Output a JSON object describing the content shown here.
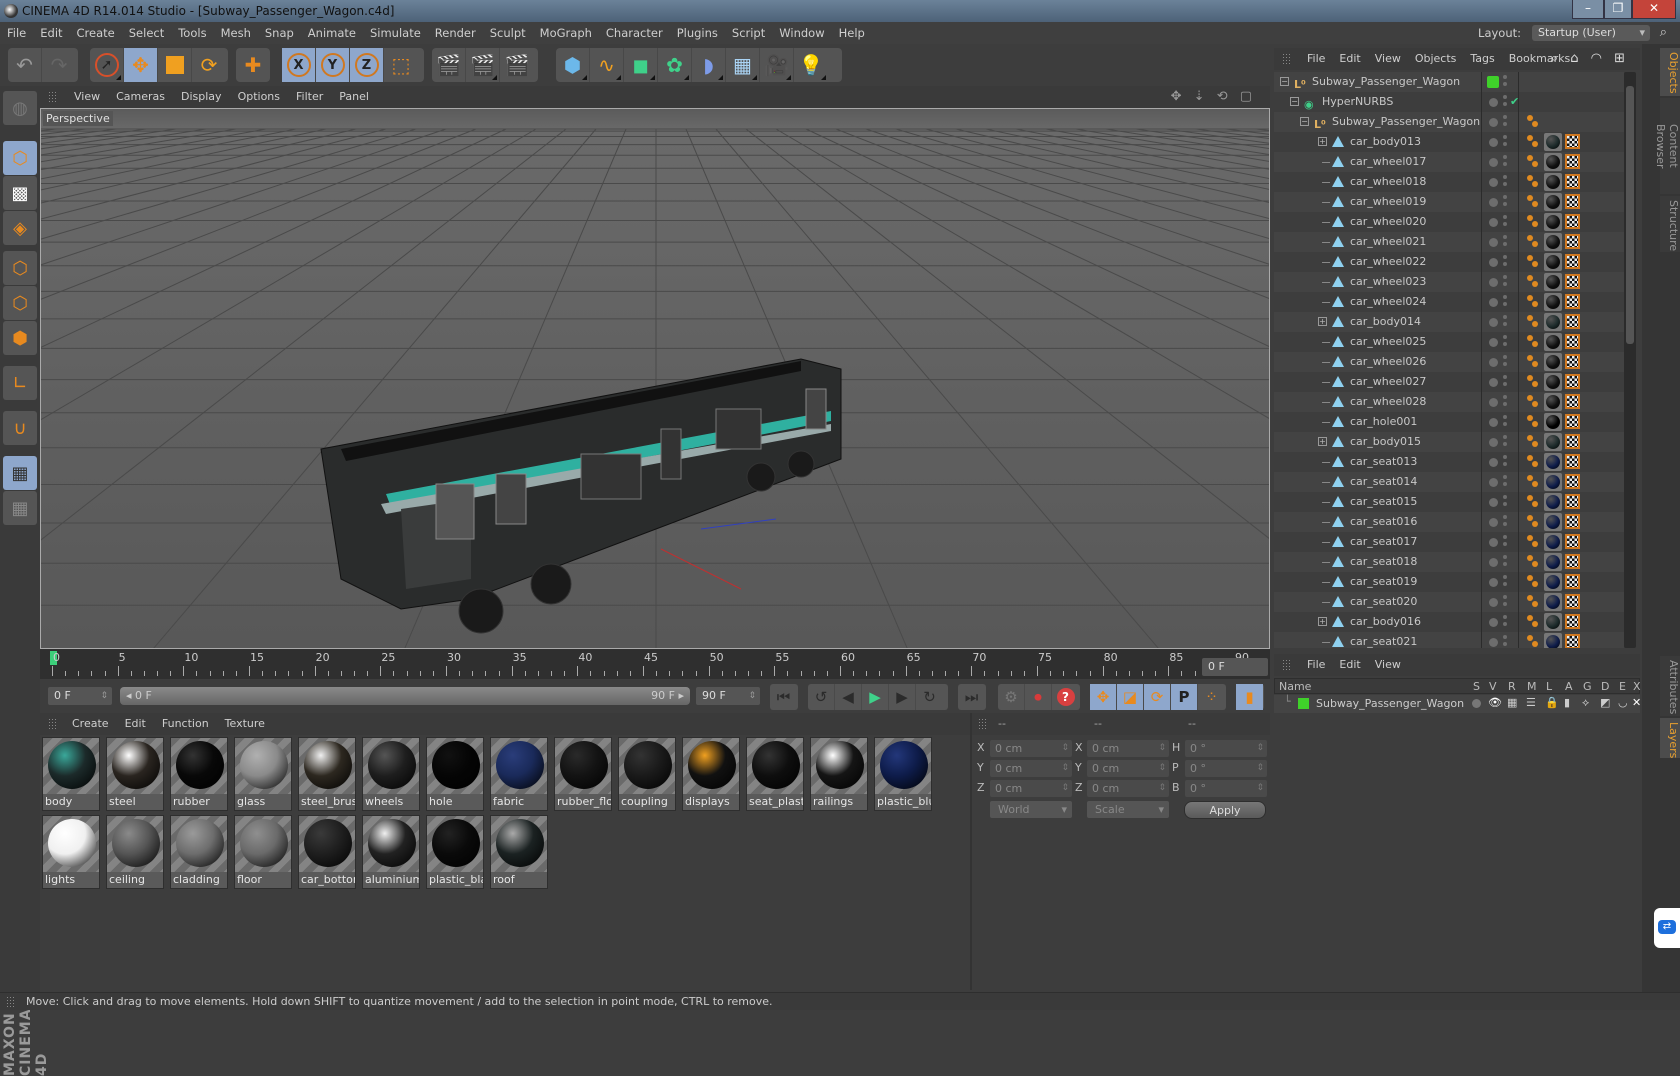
{
  "window": {
    "title": "CINEMA 4D R14.014 Studio - [Subway_Passenger_Wagon.c4d]",
    "minimize": "–",
    "maximize": "❐",
    "close": "✕"
  },
  "menubar": {
    "items": [
      "File",
      "Edit",
      "Create",
      "Select",
      "Tools",
      "Mesh",
      "Snap",
      "Animate",
      "Simulate",
      "Render",
      "Sculpt",
      "MoGraph",
      "Character",
      "Plugins",
      "Script",
      "Window",
      "Help"
    ],
    "layout_label": "Layout:",
    "layout_value": "Startup (User)"
  },
  "toolbar": {
    "groups": [
      [
        "undo-icon",
        "redo-icon"
      ],
      [
        "live-selection-icon",
        "move-icon",
        "scale-icon",
        "rotate-icon"
      ],
      [
        "last-tool-icon"
      ],
      [
        "x-axis-icon",
        "y-axis-icon",
        "z-axis-icon",
        "coordinate-system-icon"
      ],
      [
        "render-view-icon",
        "render-picture-viewer-icon",
        "render-settings-icon"
      ],
      [
        "cube-icon",
        "spline-pen-icon",
        "subdivision-surface-icon",
        "cloner-icon",
        "deformer-icon",
        "floor-icon",
        "camera-icon",
        "light-icon"
      ]
    ]
  },
  "left_tools": [
    "make-editable-icon",
    "model-mode-icon",
    "texture-mode-icon",
    "workplane-mode-icon",
    "points-mode-icon",
    "edges-mode-icon",
    "polygons-mode-icon",
    "axis-mode-icon",
    "snap-magnet-icon",
    "lock-workplane-icon",
    "workplane-rotate-icon"
  ],
  "brand": "MAXON CINEMA 4D",
  "viewport": {
    "menu": [
      "View",
      "Cameras",
      "Display",
      "Options",
      "Filter",
      "Panel"
    ],
    "label": "Perspective",
    "nav_icons": "✥ ⇣ ⟲ ▢"
  },
  "timeline": {
    "ticks": [
      "0",
      "5",
      "10",
      "15",
      "20",
      "25",
      "30",
      "35",
      "40",
      "45",
      "50",
      "55",
      "60",
      "65",
      "70",
      "75",
      "80",
      "85",
      "90"
    ],
    "current_frame": 0,
    "current_frame_field": "0 F",
    "start_field": "0 F",
    "range_start": "◂ 0 F",
    "range_end": "90 F ▸",
    "end_field": "90 F"
  },
  "playback": {
    "goto_start": "⏮",
    "prev_key": "↺",
    "prev_frame": "◀",
    "play": "▶",
    "next_frame": "▶",
    "next_key": "↻",
    "goto_end": "⏭",
    "record_keys": "⚙",
    "autokey": "⏺",
    "keyframe_selection": "?",
    "move_key": "✥",
    "scale_key": "◪",
    "rotate_key": "⟳",
    "param_key": "P",
    "pla_key": "⁘",
    "timeline_button": "▮"
  },
  "materials": {
    "menu": [
      "Create",
      "Edit",
      "Function",
      "Texture"
    ],
    "items": [
      {
        "name": "body",
        "color": "#1c2a2a",
        "hi": "#3aa89a"
      },
      {
        "name": "steel",
        "color": "#2a2520",
        "hi": "#ffffff"
      },
      {
        "name": "rubber",
        "color": "#080808",
        "hi": "#333333"
      },
      {
        "name": "glass",
        "color": "#8a8a8a",
        "hi": "#b0b0b0"
      },
      {
        "name": "steel_brush",
        "color": "#2d2820",
        "hi": "#f0f0f0"
      },
      {
        "name": "wheels",
        "color": "#1e1e1e",
        "hi": "#555555"
      },
      {
        "name": "hole",
        "color": "#050505",
        "hi": "#111111"
      },
      {
        "name": "fabric",
        "color": "#1a2a5a",
        "hi": "#2a3d7a"
      },
      {
        "name": "rubber_floor",
        "color": "#131313",
        "hi": "#2a2a2a"
      },
      {
        "name": "coupling",
        "color": "#1a1a1a",
        "hi": "#333333"
      },
      {
        "name": "displays",
        "color": "#111111",
        "hi": "#f0a020"
      },
      {
        "name": "seat_plastic",
        "color": "#0e0e0e",
        "hi": "#333333"
      },
      {
        "name": "railings",
        "color": "#151515",
        "hi": "#ffffff"
      },
      {
        "name": "plastic_blue",
        "color": "#0e1c4a",
        "hi": "#23377a"
      },
      {
        "name": "lights",
        "color": "#f0f0f0",
        "hi": "#ffffff"
      },
      {
        "name": "ceiling",
        "color": "#555555",
        "hi": "#8a8a8a"
      },
      {
        "name": "cladding",
        "color": "#6d6d6d",
        "hi": "#9a9a9a"
      },
      {
        "name": "floor",
        "color": "#6a6a6a",
        "hi": "#8f8f8f"
      },
      {
        "name": "car_bottom",
        "color": "#1f1f1f",
        "hi": "#3a3a3a"
      },
      {
        "name": "aluminium",
        "color": "#222222",
        "hi": "#f0f0f0"
      },
      {
        "name": "plastic_black",
        "color": "#0a0a0a",
        "hi": "#222222"
      },
      {
        "name": "roof",
        "color": "#1b2222",
        "hi": "#aaaaaa"
      }
    ]
  },
  "coordinates": {
    "headers": [
      "--",
      "--",
      "--"
    ],
    "pos_labels": [
      "X",
      "Y",
      "Z"
    ],
    "pos_values": [
      "0 cm",
      "0 cm",
      "0 cm"
    ],
    "size_labels": [
      "X",
      "Y",
      "Z"
    ],
    "size_values": [
      "0 cm",
      "0 cm",
      "0 cm"
    ],
    "rot_labels": [
      "H",
      "P",
      "B"
    ],
    "rot_values": [
      "0 °",
      "0 °",
      "0 °"
    ],
    "space_select": "World",
    "mode_select": "Scale",
    "apply": "Apply"
  },
  "objects_panel": {
    "menu": [
      "File",
      "Edit",
      "View",
      "Objects",
      "Tags",
      "Bookmarks"
    ],
    "menu_icons": "⌕ ⌂ ◠ ⊞",
    "rows": [
      {
        "name": "Subway_Passenger_Wagon",
        "type": "null",
        "depth": 0,
        "expand": "−",
        "layer": true
      },
      {
        "name": "HyperNURBS",
        "type": "hypernurbs",
        "depth": 1,
        "expand": "−",
        "check": "✔"
      },
      {
        "name": "Subway_Passenger_Wagon",
        "type": "null",
        "depth": 2,
        "expand": "−",
        "tags": "phong"
      },
      {
        "name": "car_body013",
        "type": "poly",
        "depth": 3,
        "expand": "+",
        "mat": "body"
      },
      {
        "name": "car_wheel017",
        "type": "poly",
        "depth": 3,
        "mat": "dark"
      },
      {
        "name": "car_wheel018",
        "type": "poly",
        "depth": 3,
        "mat": "dark"
      },
      {
        "name": "car_wheel019",
        "type": "poly",
        "depth": 3,
        "mat": "dark"
      },
      {
        "name": "car_wheel020",
        "type": "poly",
        "depth": 3,
        "mat": "dark"
      },
      {
        "name": "car_wheel021",
        "type": "poly",
        "depth": 3,
        "mat": "dark"
      },
      {
        "name": "car_wheel022",
        "type": "poly",
        "depth": 3,
        "mat": "dark"
      },
      {
        "name": "car_wheel023",
        "type": "poly",
        "depth": 3,
        "mat": "dark"
      },
      {
        "name": "car_wheel024",
        "type": "poly",
        "depth": 3,
        "mat": "dark"
      },
      {
        "name": "car_body014",
        "type": "poly",
        "depth": 3,
        "expand": "+",
        "mat": "body"
      },
      {
        "name": "car_wheel025",
        "type": "poly",
        "depth": 3,
        "mat": "dark"
      },
      {
        "name": "car_wheel026",
        "type": "poly",
        "depth": 3,
        "mat": "dark"
      },
      {
        "name": "car_wheel027",
        "type": "poly",
        "depth": 3,
        "mat": "dark"
      },
      {
        "name": "car_wheel028",
        "type": "poly",
        "depth": 3,
        "mat": "dark"
      },
      {
        "name": "car_hole001",
        "type": "poly",
        "depth": 3,
        "mat": "black"
      },
      {
        "name": "car_body015",
        "type": "poly",
        "depth": 3,
        "expand": "+",
        "mat": "body"
      },
      {
        "name": "car_seat013",
        "type": "poly",
        "depth": 3,
        "mat": "blue"
      },
      {
        "name": "car_seat014",
        "type": "poly",
        "depth": 3,
        "mat": "blue"
      },
      {
        "name": "car_seat015",
        "type": "poly",
        "depth": 3,
        "mat": "blue"
      },
      {
        "name": "car_seat016",
        "type": "poly",
        "depth": 3,
        "mat": "blue"
      },
      {
        "name": "car_seat017",
        "type": "poly",
        "depth": 3,
        "mat": "blue"
      },
      {
        "name": "car_seat018",
        "type": "poly",
        "depth": 3,
        "mat": "blue"
      },
      {
        "name": "car_seat019",
        "type": "poly",
        "depth": 3,
        "mat": "blue"
      },
      {
        "name": "car_seat020",
        "type": "poly",
        "depth": 3,
        "mat": "blue"
      },
      {
        "name": "car_body016",
        "type": "poly",
        "depth": 3,
        "expand": "+",
        "mat": "body"
      },
      {
        "name": "car_seat021",
        "type": "poly",
        "depth": 3,
        "mat": "blue"
      }
    ]
  },
  "layers_panel": {
    "menu": [
      "File",
      "Edit",
      "View"
    ],
    "columns": [
      "Name",
      "S",
      "V",
      "R",
      "M",
      "L",
      "A",
      "G",
      "D",
      "E",
      "X"
    ],
    "row": {
      "name": "Subway_Passenger_Wagon",
      "color": "#3fd12a"
    }
  },
  "right_tabs": {
    "top": [
      "Objects",
      "Content Browser",
      "Structure"
    ],
    "bottom": [
      "Attributes",
      "Layers"
    ]
  },
  "status": "Move: Click and drag to move elements. Hold down SHIFT to quantize movement / add to the selection in point mode, CTRL to remove.",
  "colors": {
    "accent_orange": "#e88a1f",
    "selected_blue": "#8ea7cc",
    "layer_green": "#3fd12a",
    "playhead_green": "#3ccf7a"
  }
}
